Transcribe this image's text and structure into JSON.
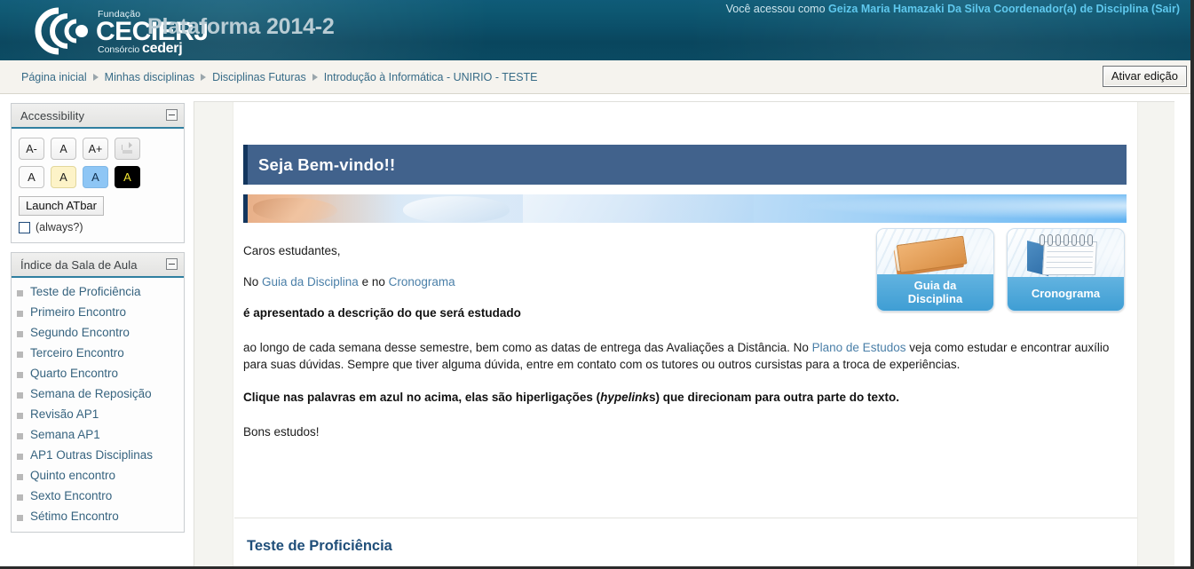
{
  "header": {
    "logo": {
      "fundacao": "Fundação",
      "cecierj": "CECIERJ",
      "consorcio": "Consórcio",
      "cederj": "cederj"
    },
    "platform_title": "Plataforma 2014-2",
    "user_prefix": "Você acessou como",
    "user_name": "Geiza Maria Hamazaki Da Silva Coordenador(a) de Disciplina",
    "logout_label": "(Sair)"
  },
  "breadcrumb": {
    "items": [
      "Página inicial",
      "Minhas disciplinas",
      "Disciplinas Futuras",
      "Introdução à Informática - UNIRIO - TESTE"
    ],
    "edit_button": "Ativar edição"
  },
  "sidebar": {
    "accessibility": {
      "title": "Accessibility",
      "size_buttons": [
        "A-",
        "A",
        "A+"
      ],
      "reset_label": "reset-icon",
      "color_buttons": [
        "A",
        "A",
        "A",
        "A"
      ],
      "launch_label": "Launch ATbar",
      "always_label": "(always?)"
    },
    "index": {
      "title": "Índice da Sala de Aula",
      "items": [
        "Teste de Proficiência",
        "Primeiro Encontro",
        "Segundo Encontro",
        "Terceiro Encontro",
        "Quarto Encontro",
        "Semana de Reposição",
        "Revisão AP1",
        "Semana AP1",
        "AP1 Outras Disciplinas",
        "Quinto encontro",
        "Sexto Encontro",
        "Sétimo Encontro"
      ]
    }
  },
  "main": {
    "welcome_title": "Seja Bem-vindo!!",
    "greeting": "Caros estudantes,",
    "line2_pre": "No ",
    "link_guia": "Guia da Disciplina",
    "line2_mid": " e no ",
    "link_crono": "Cronograma",
    "bold_line": "é apresentado a descrição do que será estudado",
    "para3_pre": "ao longo de cada semana desse semestre, bem como as datas de entrega das Avaliações a Distância. No ",
    "link_plano": "Plano de Estudos",
    "para3_post": " veja como estudar e encontrar auxílio para suas dúvidas. Sempre que tiver alguma dúvida, entre em contato com os tutores ou outros cursistas para a troca de experiências.",
    "note_pre": "Clique nas palavras em azul no acima, elas são hiperligações (",
    "note_italic": "hypelink",
    "note_post": "s) que direcionam para outra parte do texto.",
    "closing": "Bons estudos!",
    "cards": [
      {
        "label_line1": "Guia da",
        "label_line2": "Disciplina",
        "icon": "book-icon"
      },
      {
        "label_line1": "Cronograma",
        "label_line2": "",
        "icon": "calendar-icon"
      }
    ],
    "section2_title": "Teste de Proficiência"
  },
  "colors": {
    "header_blue": "#0b4f69",
    "accent_link": "#4a7fa8",
    "welcome_bar": "#41628c",
    "section_heading": "#1f4e79",
    "card_caption": "#3f9ed4"
  }
}
